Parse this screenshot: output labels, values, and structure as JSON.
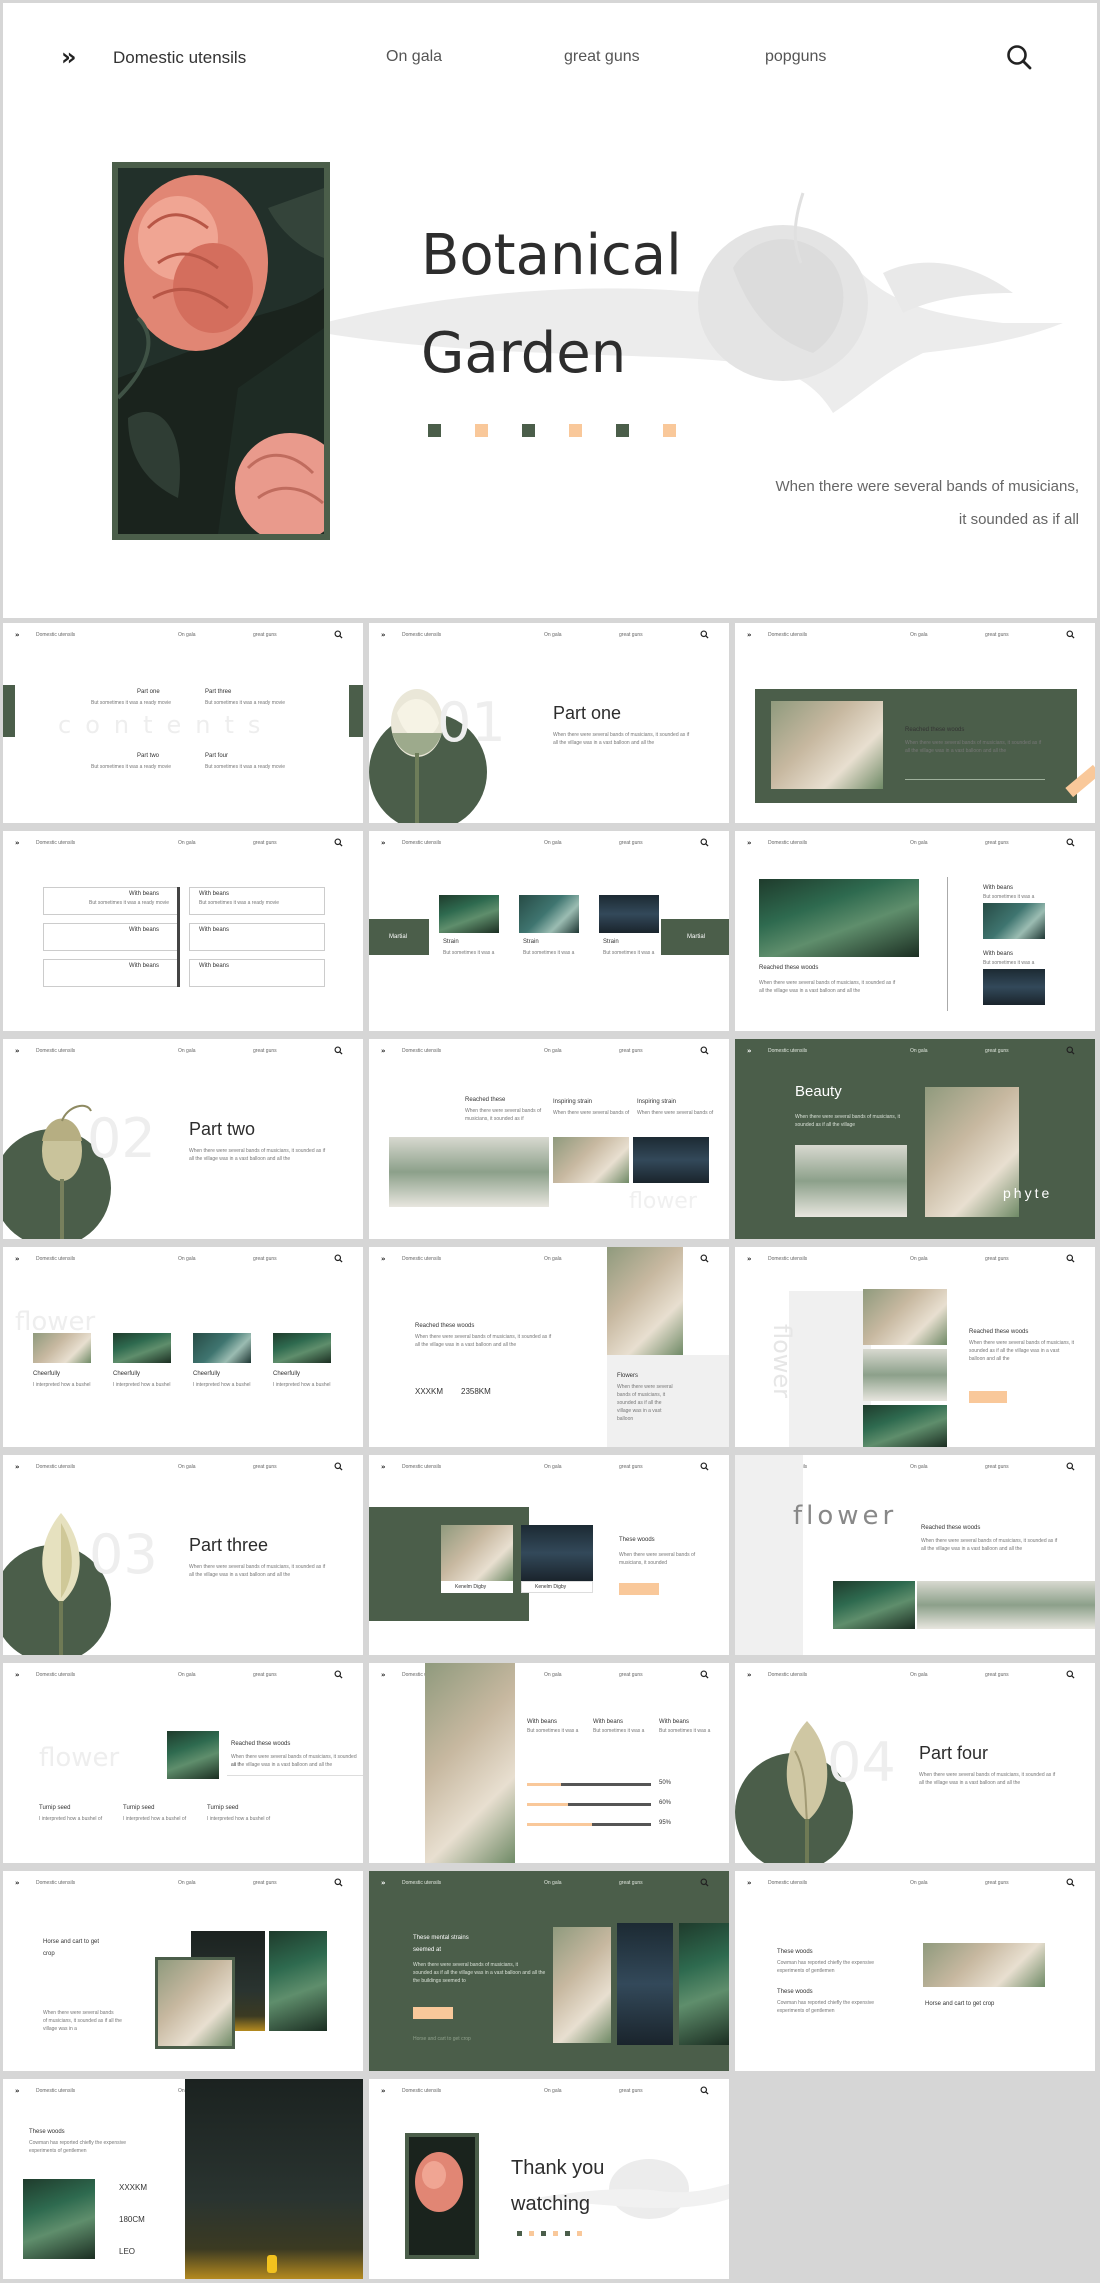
{
  "colors": {
    "green": "#4b5e4a",
    "peach": "#f9c89a",
    "white": "#ffffff",
    "background": "#d6d6d6"
  },
  "nav": {
    "arrow": "»",
    "brand": "Domestic utensils",
    "links": [
      "On gala",
      "great guns",
      "popguns"
    ],
    "search_icon": "search-icon"
  },
  "hero": {
    "title_line1": "Botanical",
    "title_line2": "Garden",
    "tagline_line1": "When there were several bands of musicians,",
    "tagline_line2": "it sounded as if all"
  },
  "slides": {
    "contents": {
      "ghost": "contents",
      "items": [
        "Part one",
        "Part three",
        "Part two",
        "Part four"
      ],
      "desc": "But sometimes it was a ready movie"
    },
    "part_one": {
      "number": "01",
      "title": "Part one",
      "desc1": "When there were several bands of musicians, it sounded as if",
      "desc2": "all the village was in a vast balloon and all the"
    },
    "reached_woods": {
      "title": "Reached these woods",
      "desc1": "When there were several bands of musicians, it sounded as if",
      "desc2": "all the village was in a vast balloon and all the"
    },
    "beans_grid": {
      "label": "With beans",
      "desc": "But sometimes it was a ready movie"
    },
    "martial": {
      "left": "Martial",
      "right": "Martial",
      "cards": [
        "Strain",
        "Strain",
        "Strain"
      ],
      "desc1": "But sometimes it was a",
      "desc2": "ready movie"
    },
    "reached_beans": {
      "title": "Reached these woods",
      "beans1": "With beans",
      "beans2": "With beans",
      "desc": "But sometimes it was a",
      "desc2": "When there were several bands of musicians, it sounded as if",
      "desc3": "all the village was in a vast balloon and all the"
    },
    "part_two": {
      "number": "02",
      "title": "Part two",
      "desc1": "When there were several bands of musicians, it sounded as if",
      "desc2": "all the village was in a vast balloon and all the"
    },
    "inspiring": {
      "cols": [
        "Reached these",
        "Inspiring strain",
        "Inspiring strain"
      ],
      "ghost": "flower",
      "desc1": "When there were several bands of",
      "desc2": "musicians, it sounded as if"
    },
    "beauty": {
      "title": "Beauty",
      "ghost": "phyte",
      "desc1": "When there were several bands of musicians, it",
      "desc2": "sounded as if all the village"
    },
    "cheerfully": {
      "ghost": "flower",
      "items": [
        "Cheerfully",
        "Cheerfully",
        "Cheerfully",
        "Cheerfully"
      ],
      "desc1": "I interpreted how a bushel",
      "desc2": "of wine to barns"
    },
    "stats": {
      "title": "Reached these woods",
      "stat1": "XXXKM",
      "stat2": "2358KM",
      "side_title": "Flowers",
      "desc1": "When there were several bands of musicians, it sounded as if",
      "desc2": "all the village was in a vast balloon and all the",
      "side_desc": "When there were several bands of musicians, it sounded as if all the village was in a vast balloon"
    },
    "vertical_flower": {
      "ghost": "flower",
      "title": "Reached these woods",
      "desc1": "When there were several bands of musicians, it",
      "desc2": "sounded as if all the village was in a vast",
      "desc3": "balloon and all the"
    },
    "part_three": {
      "number": "03",
      "title": "Part three",
      "desc1": "When there were several bands of musicians, it sounded as if",
      "desc2": "all the village was in a vast balloon and all the"
    },
    "kenelm": {
      "cap1": "Kenelm Digby",
      "cap2": "Kenelm Digby",
      "title": "These woods",
      "desc1": "When there were several bands of",
      "desc2": "musicians, it sounded"
    },
    "flower_wide": {
      "ghost": "flower",
      "title": "Reached these woods",
      "desc1": "When there were several bands of musicians, it sounded as if",
      "desc2": "all the village was in a vast balloon and all the"
    },
    "turnip": {
      "ghost": "flower",
      "title": "Reached these woods",
      "desc1": "When there were several bands of musicians, it sounded as if",
      "desc2": "all the village was in a vast balloon and all the",
      "items": [
        "Turnip seed",
        "Turnip seed",
        "Turnip seed"
      ],
      "item_desc": "I interpreted how a bushel of"
    },
    "progress": {
      "cols": [
        "With beans",
        "With beans",
        "With beans"
      ],
      "col_desc1": "But sometimes it was a",
      "col_desc2": "ready movie",
      "bars": [
        {
          "label": "50%",
          "value": 0.5
        },
        {
          "label": "60%",
          "value": 0.6
        },
        {
          "label": "95%",
          "value": 0.95
        }
      ]
    },
    "part_four": {
      "number": "04",
      "title": "Part four",
      "desc1": "When there were several bands of musicians, it sounded as if",
      "desc2": "all the village was in a vast balloon and all the"
    },
    "horse_cart": {
      "title1": "Horse and cart to get",
      "title2": "crop",
      "desc1": "When there were several bands",
      "desc2": "of musicians, it sounded as if all the",
      "desc3": "village was in a"
    },
    "mental_strains": {
      "title1": "These mental strains",
      "title2": "seemed at",
      "desc1": "When there were several bands of musicians, it",
      "desc2": "sounded as if all the village was in a vast balloon and all the",
      "desc3": "the buildings seemed to",
      "foot": "Horse and cart to get crop"
    },
    "these_woods": {
      "t1": "These woods",
      "t2": "These woods",
      "desc1": "Cowman has reported chiefly the expensive",
      "desc2": "experiments of gentlemen",
      "caption": "Horse and cart to get crop"
    },
    "forest": {
      "title": "These woods",
      "desc1": "Cowman has reported chiefly the expensive",
      "desc2": "experiments of gentlemen",
      "stats": [
        "XXXKM",
        "180CM",
        "LEO"
      ]
    },
    "thanks": {
      "line1": "Thank you",
      "line2": "watching"
    }
  }
}
